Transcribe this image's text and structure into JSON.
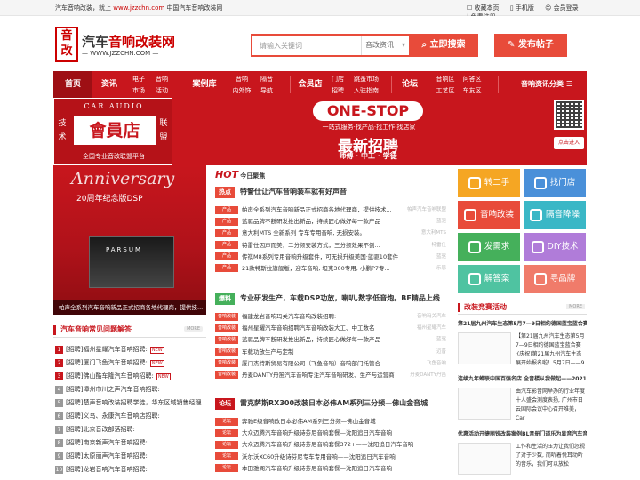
{
  "topbar": {
    "left_prefix": "汽车音响改装，就上",
    "left_url": "www.jzzchn.com",
    "left_suffix": "中国汽车音响改装网",
    "links": [
      "收藏本页",
      "手机版",
      "会员登录",
      "免费注册"
    ]
  },
  "header": {
    "logo_char1": "音",
    "logo_char2": "改",
    "title_red": "汽车",
    "title_mid": "音响改装网",
    "url": "— WWW.JZZCHN.COM —",
    "search_placeholder": "请输入关键词",
    "search_select": "音改资讯",
    "search_button": "立即搜索",
    "post_button": "发布帖子"
  },
  "nav": {
    "home": "首页",
    "zixun": "资讯",
    "zixun_sub": [
      "电子",
      "市场"
    ],
    "zixun_sub2": [
      "音响",
      "活动"
    ],
    "anli": "案例库",
    "anli_sub": [
      "音响",
      "内外饰"
    ],
    "anli_sub2": [
      "隔音",
      "导航"
    ],
    "huiyuan": "会员店",
    "huiyuan_sub": [
      "门店",
      "招聘"
    ],
    "huiyuan_sub2": [
      "跳蚤市场",
      "入驻指南"
    ],
    "luntan": "论坛",
    "luntan_sub": [
      "音响区",
      "工艺区"
    ],
    "luntan_sub2": [
      "问答区",
      "车友区"
    ],
    "category": "音响资讯分类"
  },
  "banner": {
    "car_audio": "CAR AUDIO",
    "huiyuandian": "會員店",
    "side_left": [
      "技",
      "术"
    ],
    "side_right": [
      "联",
      "盟"
    ],
    "bottom": "全国专业音改联盟平台",
    "onestop": "ONE-STOP",
    "onestop_sub": "一站式服务·找产品·找工作·找店家",
    "zhaopin": "最新招聘",
    "zhaopin_sub": "师傅 · 中工 · 学徒",
    "qr_button": "点击进入"
  },
  "feature_image": {
    "anniversary": "Anniversary",
    "dsp": "20周年纪念版DSP",
    "device": "PARSUM",
    "caption": "帕声全系列汽车音响新品正式招商各地代理商，提供技..."
  },
  "faq": {
    "title": "汽车音响常见问题解答",
    "more": "MORE",
    "items": [
      {
        "num": "1",
        "text": "[招聘]福州星耀汽车音响招聘:",
        "new": true
      },
      {
        "num": "2",
        "text": "[招聘]厦门飞鱼汽车音响招聘:",
        "new": true
      },
      {
        "num": "3",
        "text": "[招聘]佛山酷车隆汽车音响招聘:",
        "new": true
      },
      {
        "num": "4",
        "text": "[招聘]漳州市川之声汽车音响招聘:",
        "new": false
      },
      {
        "num": "5",
        "text": "[招聘]楚声音响改装招聘学徒，华东区域销售经理",
        "new": false
      },
      {
        "num": "6",
        "text": "[招聘]义乌、永康汽车音响店招聘:",
        "new": false
      },
      {
        "num": "7",
        "text": "[招聘]北京音改部落招聘:",
        "new": false
      },
      {
        "num": "8",
        "text": "[招聘]南京新声汽车音响招聘:",
        "new": false
      },
      {
        "num": "9",
        "text": "[招聘]太原丽声汽车音响招聘:",
        "new": false
      },
      {
        "num": "10",
        "text": "[招聘]龙岩音响汽车音响招聘:",
        "new": false
      }
    ]
  },
  "hot": {
    "label": "HOT",
    "sub": "今日聚焦"
  },
  "headline1": {
    "tag": "热点",
    "text": "特警仕让汽车音响装车就有好声音"
  },
  "news1": [
    {
      "tag": "产品",
      "text": "帕声全系列汽车音响新品正式招商各地代理商，提供技术...",
      "src": "帕声汽车音响联盟"
    },
    {
      "tag": "产品",
      "text": "蓝驱品牌不断研发推出新品，持续匠心做好每一款产品",
      "src": "蓝驱"
    },
    {
      "tag": "产品",
      "text": "意大利MTS 全新系列 专车专用音响, 无损安装。",
      "src": "意大利MTS"
    },
    {
      "tag": "产品",
      "text": "特雷仕因声而美，二分频安装方式，三分频效果不倒...",
      "src": "特雷仕"
    },
    {
      "tag": "产品",
      "text": "传祺M8系列专用音响升级套件，可无损升级美国·蓝驱10套件",
      "src": "蓝驱"
    },
    {
      "tag": "产品",
      "text": "21款特斯拉旗舰版，迎车音响, 坦克300专用, 小鹏P7专...",
      "src": "乐恩"
    }
  ],
  "headline2": {
    "tag": "爆料",
    "text": "专业研发生产，车载DSP功放，喇叭,数字低音炮。BF精品上线"
  },
  "news2": [
    {
      "tag": "音响改装",
      "text": "福建龙岩音响玛关汽车音响改装招聘:",
      "src": "音响玛关汽车"
    },
    {
      "tag": "音响改装",
      "text": "福州星耀汽车音响招聘汽车音响改装大工、中工数名",
      "src": "福州星耀汽车"
    },
    {
      "tag": "音响改装",
      "text": "蓝驱品牌不断研发推出新品，持续匠心做好每一款产品",
      "src": "蓝驱"
    },
    {
      "tag": "音响改装",
      "text": "车载功放生产与定制",
      "src": "迈普"
    },
    {
      "tag": "音响改装",
      "text": "厦门杰特斯贸易有限公司（飞鱼音响）音响部门托管合",
      "src": "飞鱼音响"
    },
    {
      "tag": "音响改装",
      "text": "丹麦DANTY丹笛汽车音响专注汽车音响研发、生产与运营商",
      "src": "丹麦DANTY丹笛"
    }
  ],
  "headline3": {
    "tag": "论坛",
    "text": "雷克萨斯RX300改装日本必伟AM系列三分频—佛山金音城"
  },
  "news3": [
    {
      "tag": "论坛",
      "text": "奔驰E级音响改日本必伟AM系列三分频—佛山金音城"
    },
    {
      "tag": "论坛",
      "text": "大众迈腾汽车音响升级诗芬尼音响套餐—沈阳追日汽车音响"
    },
    {
      "tag": "论坛",
      "text": "大众迈腾汽车音响升级诗芬尼音响套餐372+——沈阳追日汽车音响"
    },
    {
      "tag": "论坛",
      "text": "沃尔沃XC60升级诗芬尼专车专用音响——沈阳追日汽车音响"
    },
    {
      "tag": "论坛",
      "text": "本田雅阁汽车音响升级诗芬尼音响套餐—沈阳追日汽车音响"
    }
  ],
  "tiles": [
    {
      "label": "转二手",
      "color": "#f5a623",
      "icon": "recycle-icon"
    },
    {
      "label": "找门店",
      "color": "#4a90d9",
      "icon": "store-icon"
    },
    {
      "label": "音响改装",
      "color": "#e84b3a",
      "icon": "speaker-icon"
    },
    {
      "label": "隔音降噪",
      "color": "#3ab7c6",
      "icon": "soundproof-icon"
    },
    {
      "label": "发需求",
      "color": "#45b05b",
      "icon": "demand-icon"
    },
    {
      "label": "DIY技术",
      "color": "#b07cd9",
      "icon": "diy-icon"
    },
    {
      "label": "解答案",
      "color": "#4fc3a1",
      "icon": "answer-icon"
    },
    {
      "label": "寻品牌",
      "color": "#f07b6a",
      "icon": "brand-icon"
    }
  ],
  "race": {
    "title": "改装竞赛活动",
    "more": "MORE",
    "item1_title": "第21届九州汽车生态第5月7—9日相约德国蓝宝蓝合赛",
    "item1_text": "【第21届九州汽车生态第5月7—9日相约德国蓝宝蓝合赛·(庆祝)第21届九州汽车生态展开始报名啦！5月7日——9日 复位",
    "item2_title": "连续九年蝉联中国百强名店 全音楼从我做起——2021",
    "item2_text": "由汽车影音网举办的行业年度十人盛会测度表扬, 广州市日云国际会议中心召开唯美，Car",
    "item3_title": "优惠活动开捷丽锐改装案例BL音册门道乐为显音汽车音响",
    "item3_text": "工作和生活的压力让我们忽视了对于少数, 而听着悦耳动听的音乐，我们可以放松"
  }
}
